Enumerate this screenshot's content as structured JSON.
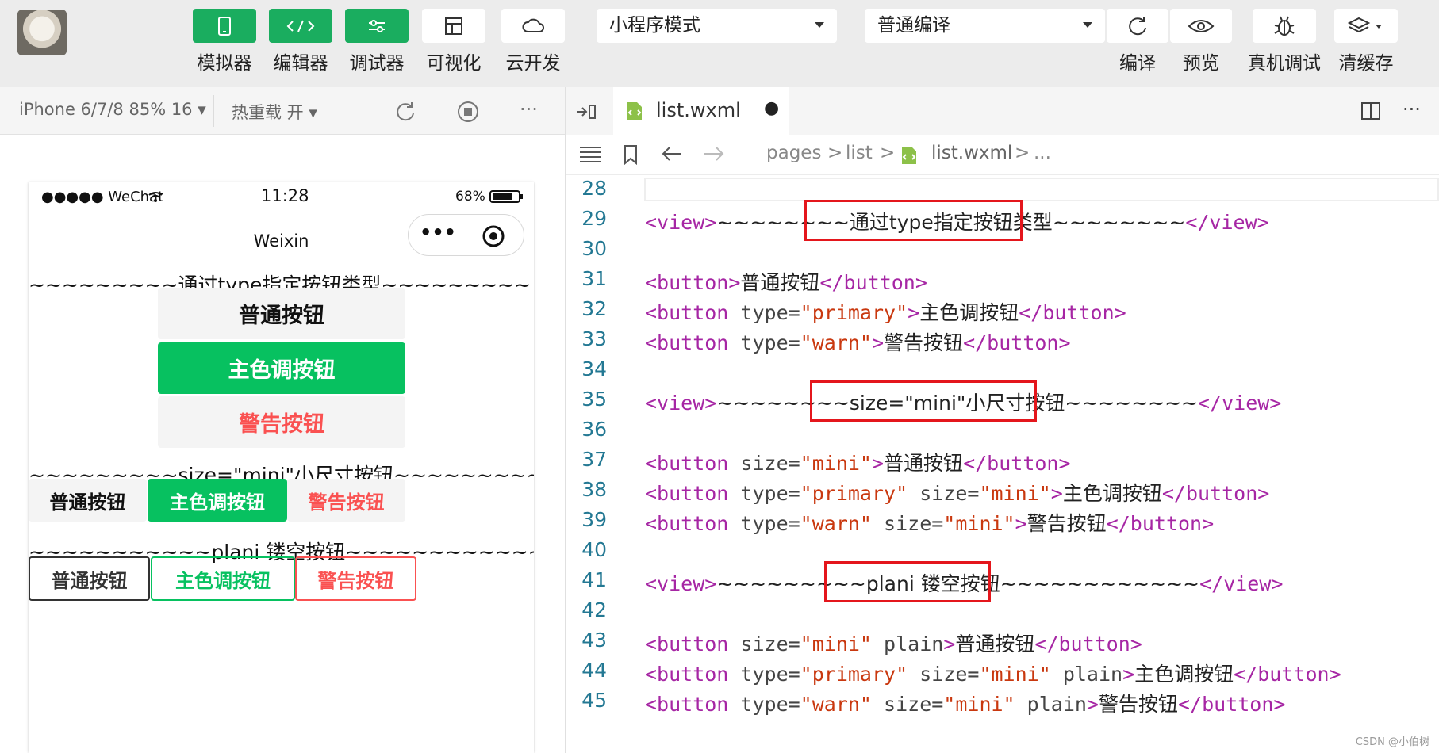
{
  "toolbar": {
    "buttons": [
      {
        "label": "模拟器",
        "icon": "phone-icon"
      },
      {
        "label": "编辑器",
        "icon": "code-icon"
      },
      {
        "label": "调试器",
        "icon": "sliders-icon"
      },
      {
        "label": "可视化",
        "icon": "layout-icon"
      },
      {
        "label": "云开发",
        "icon": "cloud-icon"
      }
    ],
    "mode_select": "小程序模式",
    "compile_select": "普通编译",
    "right_buttons": [
      {
        "label": "编译",
        "icon": "refresh-icon"
      },
      {
        "label": "预览",
        "icon": "eye-icon"
      },
      {
        "label": "真机调试",
        "icon": "bug-icon"
      },
      {
        "label": "清缓存",
        "icon": "layers-icon"
      }
    ]
  },
  "sim_toolbar": {
    "device": "iPhone 6/7/8 85% 16 ▾",
    "hot_reload": "热重载 开 ▾",
    "more": "···"
  },
  "phone": {
    "carrier": "●●●●● WeChat",
    "time": "11:28",
    "battery": "68%",
    "nav_title": "Weixin",
    "capsule_dots": "•••",
    "line1": "~~~~~~~~~通过type指定按钮类型~~~~~~~~~",
    "line2": "~~~~~~~~~size=\"mini\"小尺寸按钮~~~~~~~~~",
    "line3": "~~~~~~~~~~~plani 镂空按钮~~~~~~~~~~~~~",
    "btn_default": "普通按钮",
    "btn_primary": "主色调按钮",
    "btn_warn": "警告按钮"
  },
  "editor": {
    "tab_name": "list.wxml",
    "tab_dot": "●",
    "more": "···",
    "breadcrumb": [
      "pages",
      "list",
      "list.wxml",
      "..."
    ],
    "sep": ">",
    "line_numbers": [
      "28",
      "29",
      "30",
      "31",
      "32",
      "33",
      "34",
      "35",
      "36",
      "37",
      "38",
      "39",
      "40",
      "41",
      "42",
      "43",
      "44",
      "45"
    ],
    "code": {
      "view_open": "<view>",
      "view_close": "</view>",
      "button_open": "<button",
      "button_simple_open": "<button>",
      "button_close": "</button>",
      "gt": ">",
      "type_attr": " type=",
      "size_attr": " size=",
      "plain_attr": " plain",
      "v_primary": "\"primary\"",
      "v_warn": "\"warn\"",
      "v_mini": "\"mini\"",
      "tilde8": "~~~~~~~~",
      "tilde9": "~~~~~~~~~",
      "tilde12": "~~~~~~~~~~~~",
      "l29_text": "通过type指定按钮类型",
      "l35_text": "size=\"mini\"小尺寸按钮",
      "l41_text": "plani 镂空按钮",
      "default": "普通按钮",
      "primary": "主色调按钮",
      "warn": "警告按钮"
    }
  },
  "watermark": "CSDN @小伯树",
  "colors": {
    "green": "#1aad5f",
    "wx_green": "#07c160",
    "warn_red": "#fa5151",
    "highlight": "#e4161c"
  }
}
